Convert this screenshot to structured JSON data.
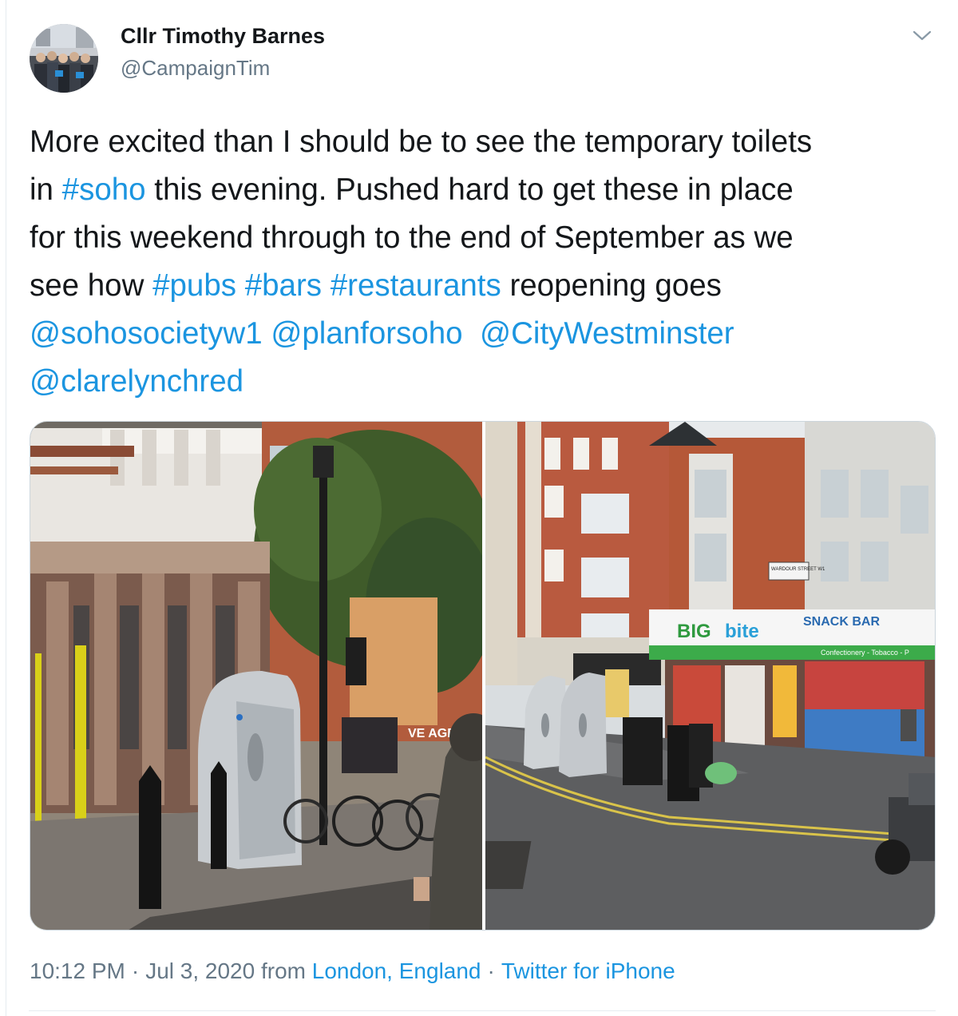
{
  "author": {
    "name": "Cllr Timothy Barnes",
    "handle": "@CampaignTim"
  },
  "tweet": {
    "lines": [
      [
        {
          "text": "More excited than I should be to see the temporary toilets",
          "link": false
        }
      ],
      [
        {
          "text": "in ",
          "link": false
        },
        {
          "text": "#soho",
          "link": true
        },
        {
          "text": " this evening. Pushed hard to get these in place",
          "link": false
        }
      ],
      [
        {
          "text": "for this weekend through to the end of September as we",
          "link": false
        }
      ],
      [
        {
          "text": "see how ",
          "link": false
        },
        {
          "text": "#pubs",
          "link": true
        },
        {
          "text": " ",
          "link": false
        },
        {
          "text": "#bars",
          "link": true
        },
        {
          "text": " ",
          "link": false
        },
        {
          "text": "#restaurants",
          "link": true
        },
        {
          "text": " reopening goes",
          "link": false
        }
      ],
      [
        {
          "text": "@sohosocietyw1",
          "link": true
        },
        {
          "text": " ",
          "link": false
        },
        {
          "text": "@planforsoho",
          "link": true
        },
        {
          "text": "  ",
          "link": false
        },
        {
          "text": "@CityWestminster",
          "link": true
        }
      ],
      [
        {
          "text": "@clarelynchred",
          "link": true
        }
      ]
    ]
  },
  "photos": {
    "left": {
      "sign_text": "VE AGE"
    },
    "right": {
      "shop_name_big": "BIG",
      "shop_name_bite": "bite",
      "snack_bar": "SNACK BAR",
      "confectionery": "Confectionery - Tobacco - P",
      "street_sign": "WARDOUR STREET W1"
    }
  },
  "meta": {
    "time": "10:12 PM",
    "date": "Jul 3, 2020",
    "from": "from",
    "location": "London, England",
    "separator": "·",
    "source": "Twitter for iPhone"
  },
  "colors": {
    "link": "#1b95e0",
    "text": "#14171a",
    "secondary": "#657786",
    "border": "#e6ecf0"
  },
  "icons": {
    "more": "chevron-down-icon"
  }
}
